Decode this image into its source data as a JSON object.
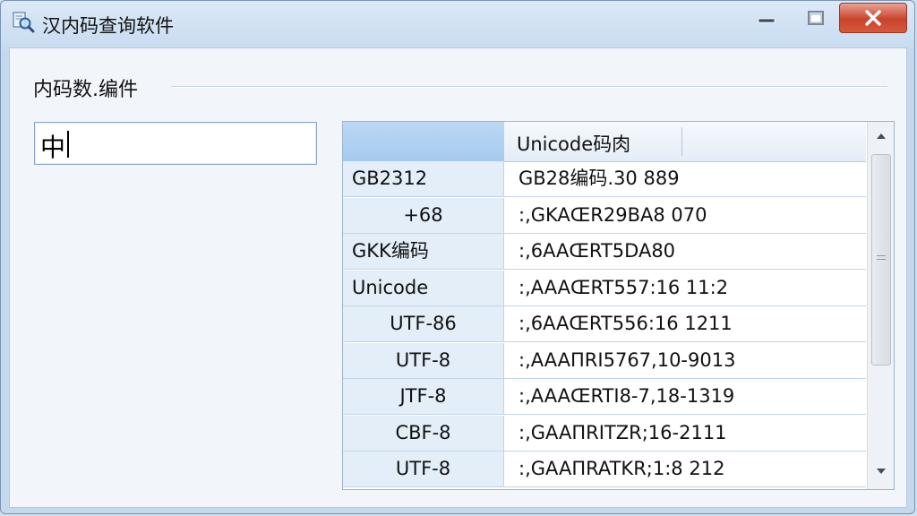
{
  "window": {
    "title": "汉内码查询软件",
    "icon": "magnifier-icon"
  },
  "controls": {
    "minimize_icon": "minimize-icon",
    "maximize_icon": "maximize-icon",
    "close_icon": "close-icon"
  },
  "group": {
    "label": "内码数.编件"
  },
  "input": {
    "value": "中"
  },
  "grid": {
    "header": {
      "col1": "",
      "col2": "Unicode码肉"
    },
    "rows": [
      {
        "name": "GB2312",
        "value": "GB28编码.30 889"
      },
      {
        "name": "+68",
        "value": ":,GKAŒR29BA8 070"
      },
      {
        "name": "GKK编码",
        "value": ":,6AAŒRT5DA80"
      },
      {
        "name": "Unicode",
        "value": ":,AAAŒRT557:16 11:2"
      },
      {
        "name": "UTF-86",
        "value": ":,6AAŒRT556:16 1211"
      },
      {
        "name": "UTF-8",
        "value": ":,AAAΠRI5767,10-9013"
      },
      {
        "name": "JTF-8",
        "value": ":,AAAŒRTI8-7,18-1319"
      },
      {
        "name": "CBF-8",
        "value": ":,GAAΠRITZR;16-2111"
      },
      {
        "name": "UTF-8",
        "value": ":,GAAΠRATKR;1:8 212"
      }
    ]
  },
  "colors": {
    "accent": "#a6caee",
    "close_button": "#c9432a",
    "row_divider": "#c3d4e6"
  }
}
